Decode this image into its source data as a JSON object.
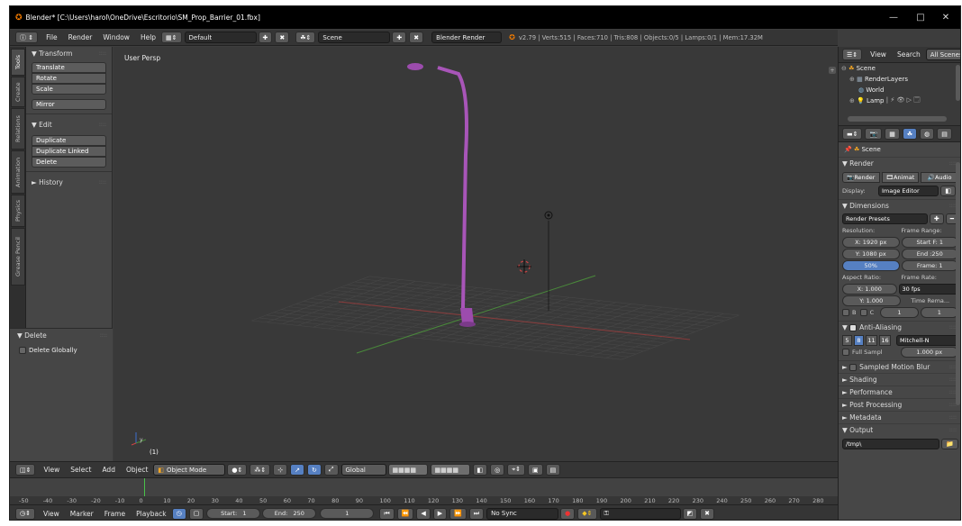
{
  "window": {
    "title": "Blender* [C:\\Users\\harol\\OneDrive\\Escritorio\\SM_Prop_Barrier_01.fbx]",
    "minimize": "—",
    "maximize": "□",
    "close": "✕"
  },
  "infobar": {
    "menus": [
      "File",
      "Render",
      "Window",
      "Help"
    ],
    "layout": "Default",
    "scene": "Scene",
    "engine": "Blender Render",
    "stats": "v2.79 | Verts:515 | Faces:710 | Tris:808 | Objects:0/5 | Lamps:0/1 | Mem:17.32M"
  },
  "toolshelf": {
    "tabs": [
      "Tools",
      "Create",
      "Relations",
      "Animation",
      "Physics",
      "Grease Pencil"
    ],
    "transform_header": "Transform",
    "transform_buttons": [
      "Translate",
      "Rotate",
      "Scale"
    ],
    "mirror": "Mirror",
    "edit_header": "Edit",
    "edit_buttons": [
      "Duplicate",
      "Duplicate Linked",
      "Delete"
    ],
    "history_header": "History",
    "delete_header": "Delete",
    "delete_globally": "Delete Globally"
  },
  "viewport": {
    "label": "User Persp",
    "frame": "(1)",
    "axis_x": "x",
    "axis_y": "y",
    "axis_z": "z"
  },
  "view3d_header": {
    "menus": [
      "View",
      "Select",
      "Add",
      "Object"
    ],
    "mode": "Object Mode",
    "orientation": "Global"
  },
  "timeline": {
    "ticks": [
      "-50",
      "-40",
      "-30",
      "-20",
      "-10",
      "0",
      "10",
      "20",
      "30",
      "40",
      "50",
      "60",
      "70",
      "80",
      "90",
      "100",
      "110",
      "120",
      "130",
      "140",
      "150",
      "160",
      "170",
      "180",
      "190",
      "200",
      "210",
      "220",
      "230",
      "240",
      "250",
      "260",
      "270",
      "280"
    ],
    "current_frame": 1
  },
  "timeline_header": {
    "menus": [
      "View",
      "Marker",
      "Frame",
      "Playback"
    ],
    "start_label": "Start:",
    "start": "1",
    "end_label": "End:",
    "end": "250",
    "current": "1",
    "sync": "No Sync"
  },
  "outliner": {
    "header_items": [
      "View",
      "Search",
      "All Scenes"
    ],
    "items": [
      "Scene",
      "RenderLayers",
      "World",
      "Lamp"
    ]
  },
  "properties": {
    "context": "Scene",
    "render_header": "Render",
    "render_buttons": [
      "Render",
      "Animat",
      "Audio"
    ],
    "display_label": "Display:",
    "display_value": "Image Editor",
    "dimensions_header": "Dimensions",
    "render_presets": "Render Presets",
    "resolution_label": "Resolution:",
    "frame_range_label": "Frame Range:",
    "res_x": "X: 1920 px",
    "res_y": "Y: 1080 px",
    "res_pct": "50%",
    "start_frame": "Start F: 1",
    "end_frame": "End :250",
    "frame_step": "Frame: 1",
    "aspect_label": "Aspect Ratio:",
    "framerate_label": "Frame Rate:",
    "aspect_x": "X: 1.000",
    "aspect_y": "Y: 1.000",
    "fps": "30 fps",
    "time_remap": "Time Rema...",
    "border_b": "B",
    "border_c": "C",
    "remap_old": "1",
    "remap_new": "1",
    "aa_header": "Anti-Aliasing",
    "aa_samples": [
      "5",
      "8",
      "11",
      "16"
    ],
    "aa_active": "8",
    "aa_filter": "Mitchell-N",
    "full_sample": "Full Sampl",
    "filter_size": "1.000 px",
    "collapsed_panels": [
      "Sampled Motion Blur",
      "Shading",
      "Performance",
      "Post Processing",
      "Metadata"
    ],
    "output_header": "Output",
    "output_path": "/tmp\\"
  }
}
